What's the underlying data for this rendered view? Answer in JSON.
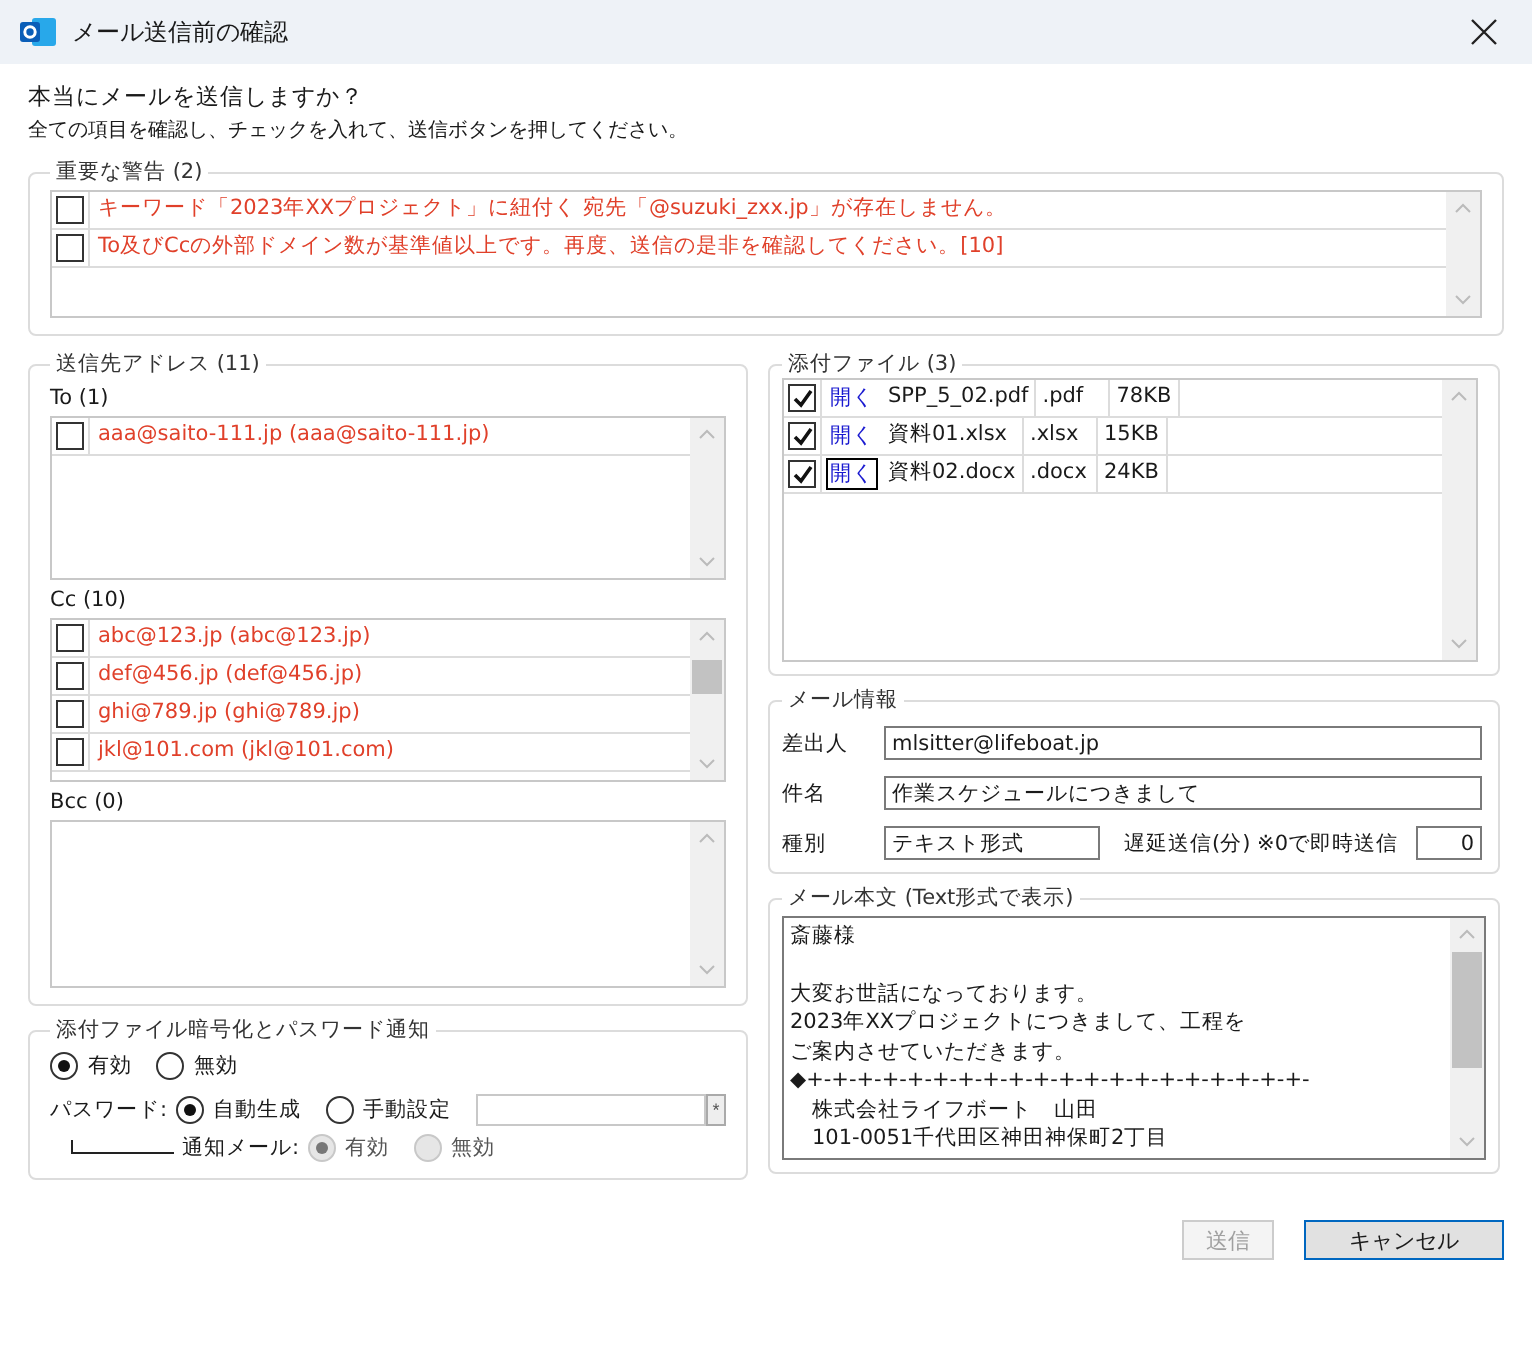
{
  "window": {
    "title": "メール送信前の確認"
  },
  "intro": {
    "question": "本当にメールを送信しますか？",
    "instruction": "全ての項目を確認し、チェックを入れて、送信ボタンを押してください。"
  },
  "warnings": {
    "legend": "重要な警告 (2)",
    "items": [
      {
        "text": "キーワード「2023年XXプロジェクト」に紐付く 宛先「@suzuki_zxx.jp」が存在しません。",
        "checked": false
      },
      {
        "text": "To及びCcの外部ドメイン数が基準値以上です。再度、送信の是非を確認してください。[10]",
        "checked": false
      }
    ]
  },
  "recipients": {
    "legend": "送信先アドレス (11)",
    "groups": [
      {
        "label": "To (1)",
        "items": [
          {
            "text": "aaa@saito-111.jp (aaa@saito-111.jp)",
            "checked": false
          }
        ]
      },
      {
        "label": "Cc (10)",
        "items": [
          {
            "text": "abc@123.jp (abc@123.jp)",
            "checked": false
          },
          {
            "text": "def@456.jp (def@456.jp)",
            "checked": false
          },
          {
            "text": "ghi@789.jp (ghi@789.jp)",
            "checked": false
          },
          {
            "text": "jkl@101.com (jkl@101.com)",
            "checked": false
          }
        ]
      },
      {
        "label": "Bcc (0)"
      }
    ]
  },
  "encryption": {
    "legend": "添付ファイル暗号化とパスワード通知",
    "enable_options": [
      {
        "label": "有効",
        "selected": true
      },
      {
        "label": "無効",
        "selected": false
      }
    ],
    "password_label": "パスワード:",
    "password_options": [
      {
        "label": "自動生成",
        "selected": true
      },
      {
        "label": "手動設定",
        "selected": false
      }
    ],
    "mask_button": "*",
    "notify_label": "通知メール:",
    "notify_options": [
      {
        "label": "有効",
        "selected": true,
        "disabled": true
      },
      {
        "label": "無効",
        "selected": false,
        "disabled": true
      }
    ]
  },
  "attachments": {
    "legend": "添付ファイル (3)",
    "files": [
      {
        "checked": true,
        "open": "開く",
        "focused": false,
        "name": "SPP_5_02.pdf",
        "ext": ".pdf",
        "size": "78KB"
      },
      {
        "checked": true,
        "open": "開く",
        "focused": false,
        "name": "資料01.xlsx",
        "ext": ".xlsx",
        "size": "15KB"
      },
      {
        "checked": true,
        "open": "開く",
        "focused": true,
        "name": "資料02.docx",
        "ext": ".docx",
        "size": "24KB"
      }
    ]
  },
  "mail_info": {
    "legend": "メール情報",
    "sender_label": "差出人",
    "sender": "mlsitter@lifeboat.jp",
    "subject_label": "件名",
    "subject": "作業スケジュールにつきまして",
    "type_label": "種別",
    "type": "テキスト形式",
    "delay_label": "遅延送信(分) ※0で即時送信",
    "delay": "0"
  },
  "body": {
    "legend": "メール本文 (Text形式で表示)",
    "paragraphs": [
      [
        "斎藤様"
      ],
      [
        "大変お世話になっております。",
        "2023年XXプロジェクトにつきまして、工程を",
        "ご案内させていただきます。",
        "◆+-+-+-+-+-+-+-+-+-+-+-+-+-+-+-+-+-+-+-+-",
        "　株式会社ライフボート　山田",
        "　101-0051千代田区神田神保町2丁目"
      ]
    ]
  },
  "buttons": [
    {
      "label": "送信",
      "disabled": true,
      "default": false
    },
    {
      "label": "キャンセル",
      "disabled": false,
      "default": true
    }
  ]
}
